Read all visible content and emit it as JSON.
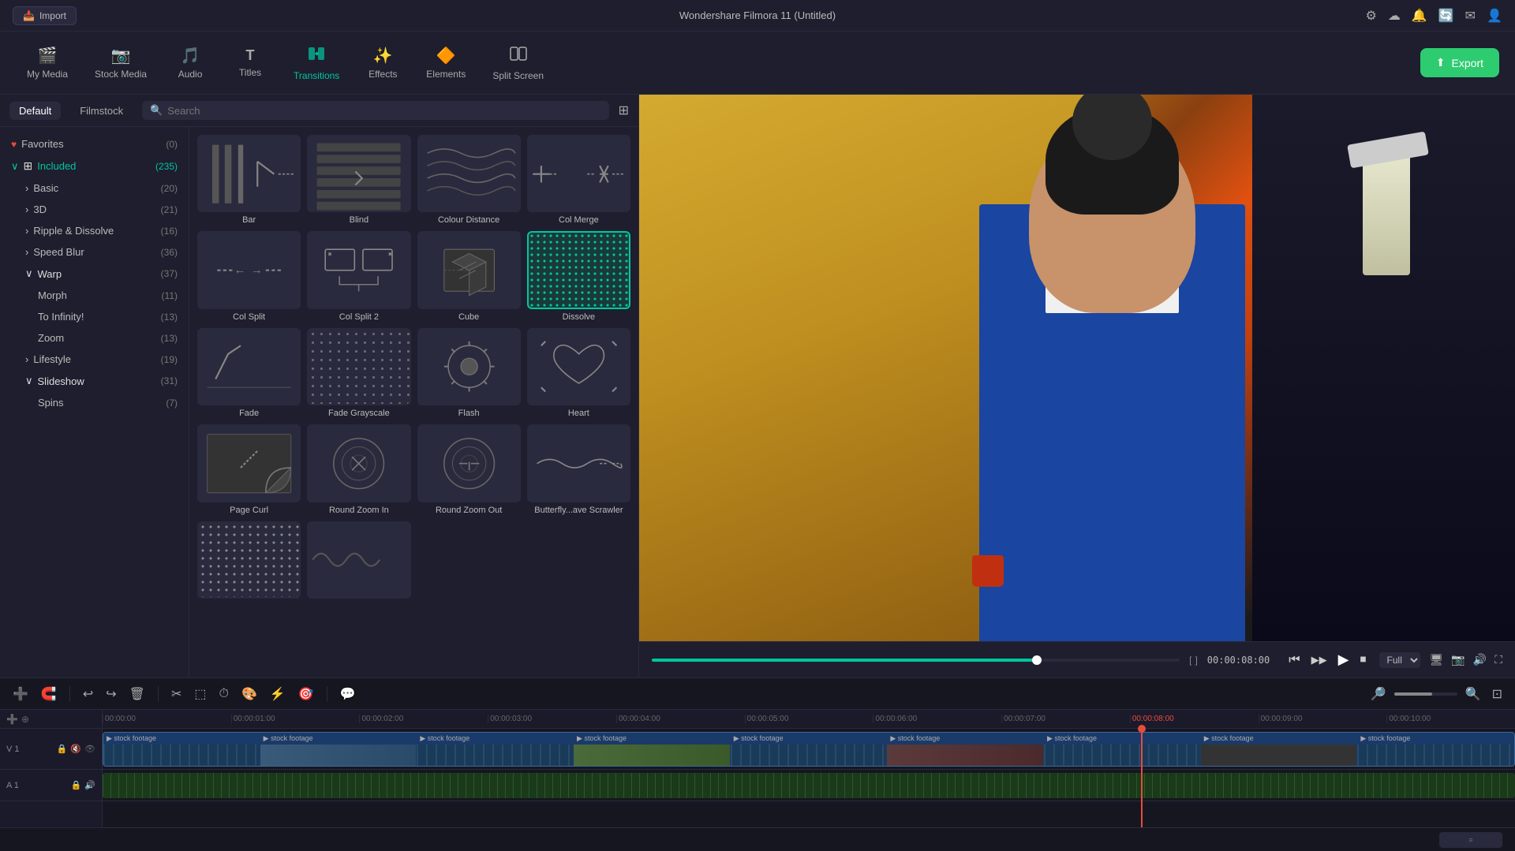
{
  "app": {
    "title": "Wondershare Filmora 11 (Untitled)",
    "import_label": "Import"
  },
  "toolbar": {
    "items": [
      {
        "id": "my-media",
        "label": "My Media",
        "icon": "🎬"
      },
      {
        "id": "stock-media",
        "label": "Stock Media",
        "icon": "📷"
      },
      {
        "id": "audio",
        "label": "Audio",
        "icon": "🎵"
      },
      {
        "id": "titles",
        "label": "Titles",
        "icon": "T"
      },
      {
        "id": "transitions",
        "label": "Transitions",
        "icon": "↔",
        "active": true
      },
      {
        "id": "effects",
        "label": "Effects",
        "icon": "✨"
      },
      {
        "id": "elements",
        "label": "Elements",
        "icon": "🔶"
      },
      {
        "id": "split-screen",
        "label": "Split Screen",
        "icon": "⬜"
      }
    ],
    "export_label": "Export"
  },
  "panel": {
    "tabs": [
      {
        "id": "default",
        "label": "Default"
      },
      {
        "id": "filmstock",
        "label": "Filmstock"
      }
    ],
    "search_placeholder": "Search",
    "sidebar": {
      "items": [
        {
          "id": "favorites",
          "label": "Favorites",
          "count": "(0)",
          "icon": "heart",
          "indent": 0
        },
        {
          "id": "included",
          "label": "Included",
          "count": "(235)",
          "icon": "grid",
          "indent": 0,
          "expanded": true
        },
        {
          "id": "basic",
          "label": "Basic",
          "count": "(20)",
          "indent": 1
        },
        {
          "id": "3d",
          "label": "3D",
          "count": "(21)",
          "indent": 1
        },
        {
          "id": "ripple",
          "label": "Ripple & Dissolve",
          "count": "(16)",
          "indent": 1
        },
        {
          "id": "speedblur",
          "label": "Speed Blur",
          "count": "(36)",
          "indent": 1
        },
        {
          "id": "warp",
          "label": "Warp",
          "count": "(37)",
          "indent": 1,
          "expanded": true
        },
        {
          "id": "morph",
          "label": "Morph",
          "count": "(11)",
          "indent": 2
        },
        {
          "id": "infinity",
          "label": "To Infinity!",
          "count": "(13)",
          "indent": 2
        },
        {
          "id": "zoom",
          "label": "Zoom",
          "count": "(13)",
          "indent": 2
        },
        {
          "id": "lifestyle",
          "label": "Lifestyle",
          "count": "(19)",
          "indent": 1
        },
        {
          "id": "slideshow",
          "label": "Slideshow",
          "count": "(31)",
          "indent": 1,
          "expanded": true
        },
        {
          "id": "spins",
          "label": "Spins",
          "count": "(7)",
          "indent": 2
        }
      ]
    },
    "transitions": [
      {
        "id": "bar",
        "label": "Bar",
        "type": "bar"
      },
      {
        "id": "blind",
        "label": "Blind",
        "type": "blind"
      },
      {
        "id": "colour-distance",
        "label": "Colour Distance",
        "type": "colour"
      },
      {
        "id": "col-merge",
        "label": "Col Merge",
        "type": "colmerge"
      },
      {
        "id": "col-split",
        "label": "Col Split",
        "type": "colsplit"
      },
      {
        "id": "col-split-2",
        "label": "Col Split 2",
        "type": "colsplit2"
      },
      {
        "id": "cube",
        "label": "Cube",
        "type": "cube"
      },
      {
        "id": "dissolve",
        "label": "Dissolve",
        "type": "dissolve",
        "selected": true
      },
      {
        "id": "fade",
        "label": "Fade",
        "type": "fade"
      },
      {
        "id": "fade-grayscale",
        "label": "Fade Grayscale",
        "type": "fadegray"
      },
      {
        "id": "flash",
        "label": "Flash",
        "type": "flash"
      },
      {
        "id": "heart",
        "label": "Heart",
        "type": "heart"
      },
      {
        "id": "page-curl",
        "label": "Page Curl",
        "type": "pagecurl"
      },
      {
        "id": "round-zoom-in",
        "label": "Round Zoom In",
        "type": "roundzoomin"
      },
      {
        "id": "round-zoom-out",
        "label": "Round Zoom Out",
        "type": "roundzoomout"
      },
      {
        "id": "butterfly",
        "label": "Butterfly...ave Scrawler",
        "type": "butterfly"
      },
      {
        "id": "partial1",
        "label": "",
        "type": "partial1"
      },
      {
        "id": "partial2",
        "label": "",
        "type": "partial2"
      }
    ]
  },
  "playback": {
    "time_display": "00:00:08:00",
    "quality": "Full",
    "progress_percent": 73
  },
  "timeline": {
    "ruler_marks": [
      "00:00:00",
      "00:00:01:00",
      "00:00:02:00",
      "00:00:03:00",
      "00:00:04:00",
      "00:00:05:00",
      "00:00:06:00",
      "00:00:07:00",
      "00:00:08:00",
      "00:00:09:00",
      "00:00:10:00"
    ],
    "tracks": [
      {
        "id": "v1",
        "type": "video",
        "label": "V 1",
        "clips": 9
      },
      {
        "id": "a1",
        "type": "audio",
        "label": "A 1"
      }
    ]
  },
  "icons": {
    "undo": "↩",
    "redo": "↪",
    "delete": "🗑",
    "cut": "✂",
    "crop": "⬚",
    "history": "⏱",
    "equalizer": "≡",
    "color": "🎨",
    "speed": "⚡",
    "zoom_in": "🔍",
    "zoom_out": "🔎",
    "search": "🔍",
    "grid": "⊞",
    "play": "▶",
    "pause": "⏸",
    "stop": "⏹",
    "frame_prev": "⏮",
    "frame_next": "⏭",
    "volume": "🔊",
    "fullscreen": "⛶",
    "settings": "⚙",
    "cloud": "☁",
    "bell": "🔔",
    "message": "✉",
    "user": "👤",
    "chevron_right": "›",
    "chevron_down": "∨",
    "camera": "📷",
    "mic": "🎤",
    "scissors": "✂",
    "lock": "🔒",
    "eye": "👁",
    "speaker": "🔊",
    "snap": "⊕"
  }
}
